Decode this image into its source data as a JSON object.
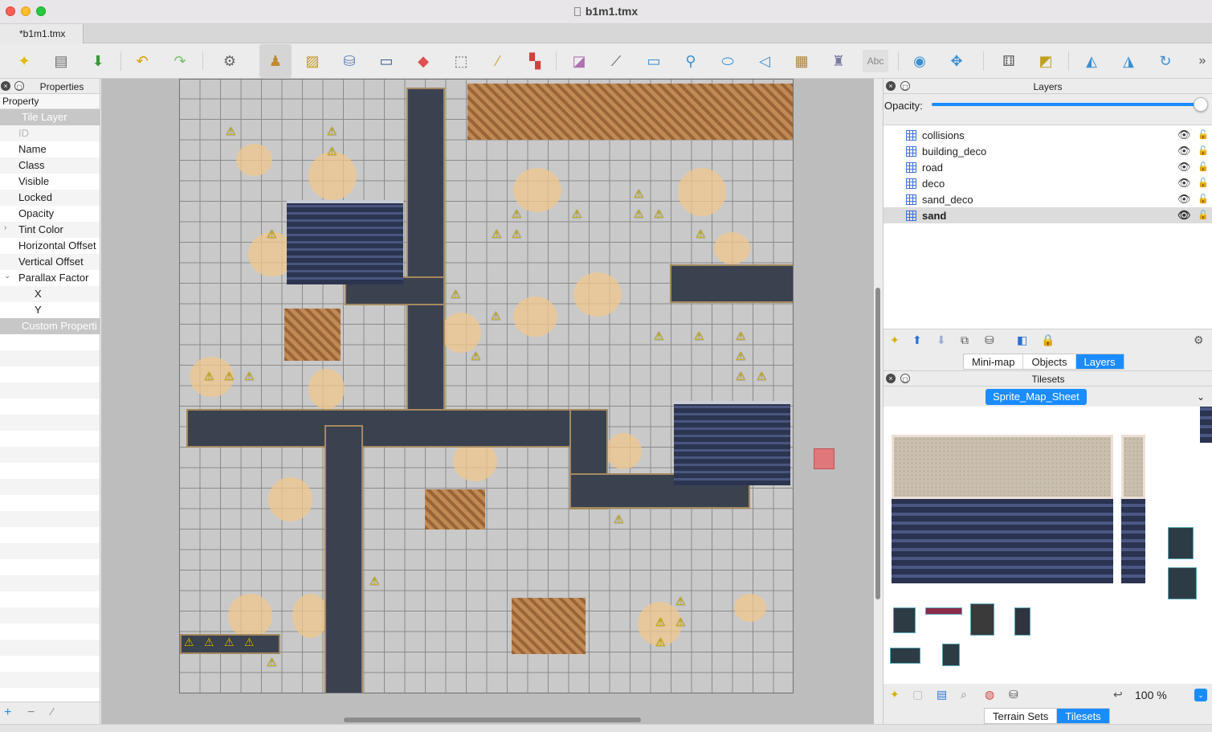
{
  "window": {
    "title": "b1m1.tmx"
  },
  "document_tab": {
    "label": "*b1m1.tmx"
  },
  "toolbar": {
    "icons": [
      "new-map-icon",
      "open-icon",
      "save-icon",
      "undo-icon",
      "redo-icon",
      "commands-icon",
      "stamp-brush-icon",
      "terrain-brush-icon",
      "bucket-fill-icon",
      "shape-fill-icon",
      "eraser-icon",
      "rect-select-icon",
      "magic-wand-icon",
      "select-same-icon",
      "select-objects-icon",
      "edit-polygons-icon",
      "insert-rectangle-icon",
      "insert-point-icon",
      "insert-ellipse-icon",
      "insert-polygon-icon",
      "insert-tile-icon",
      "insert-template-icon",
      "insert-text-icon",
      "world-tool-icon",
      "move-icon",
      "random-mode-icon",
      "wang-fill-icon",
      "flip-horizontal-icon",
      "flip-vertical-icon",
      "rotate-icon",
      "more-icon"
    ],
    "text_tool_label": "Abc"
  },
  "properties": {
    "title": "Properties",
    "column_header": "Property",
    "group_label": "Tile Layer",
    "rows": [
      "ID",
      "Name",
      "Class",
      "Visible",
      "Locked",
      "Opacity",
      "Tint Color",
      "Horizontal Offset",
      "Vertical Offset",
      "Parallax Factor",
      "X",
      "Y"
    ],
    "custom_group_label": "Custom Properti"
  },
  "layers_panel": {
    "title": "Layers",
    "opacity_label": "Opacity:",
    "opacity_value": 1.0,
    "layers": [
      {
        "name": "collisions",
        "selected": false
      },
      {
        "name": "building_deco",
        "selected": false
      },
      {
        "name": "road",
        "selected": false
      },
      {
        "name": "deco",
        "selected": false
      },
      {
        "name": "sand_deco",
        "selected": false
      },
      {
        "name": "sand",
        "selected": true
      }
    ],
    "tabs": [
      "Mini-map",
      "Objects",
      "Layers"
    ],
    "active_tab": "Layers"
  },
  "tilesets_panel": {
    "title": "Tilesets",
    "active_tileset": "Sprite_Map_Sheet",
    "zoom": "100 %",
    "tabs": [
      "Terrain Sets",
      "Tilesets"
    ],
    "active_tab": "Tilesets"
  },
  "colors": {
    "accent": "#1a8cff",
    "road": "#3a4250",
    "sand": "#f0c78c",
    "selected_tile": "#e0777a"
  }
}
